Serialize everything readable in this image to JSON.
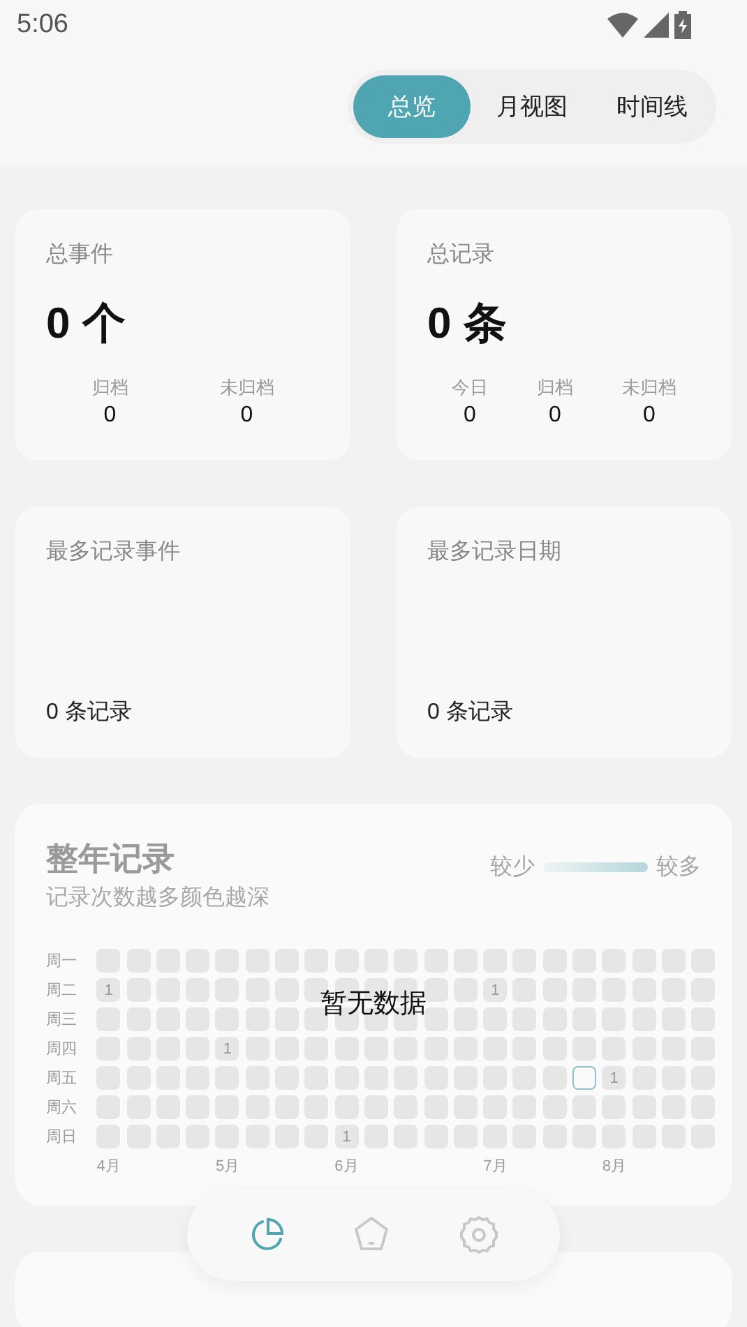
{
  "status_bar": {
    "time": "5:06"
  },
  "tabs": [
    {
      "label": "总览",
      "selected": true
    },
    {
      "label": "月视图",
      "selected": false
    },
    {
      "label": "时间线",
      "selected": false
    }
  ],
  "summary_cards": [
    {
      "title": "总事件",
      "value": "0 个",
      "stats": [
        {
          "label": "归档",
          "value": "0"
        },
        {
          "label": "未归档",
          "value": "0"
        }
      ]
    },
    {
      "title": "总记录",
      "value": "0 条",
      "stats": [
        {
          "label": "今日",
          "value": "0"
        },
        {
          "label": "归档",
          "value": "0"
        },
        {
          "label": "未归档",
          "value": "0"
        }
      ]
    }
  ],
  "top_cards": [
    {
      "title": "最多记录事件",
      "footer": "0 条记录"
    },
    {
      "title": "最多记录日期",
      "footer": "0 条记录"
    }
  ],
  "year_card": {
    "title": "整年记录",
    "subtitle": "记录次数越多颜色越深",
    "legend_low": "较少",
    "legend_high": "较多",
    "empty_message": "暂无数据",
    "weekdays": [
      "周一",
      "周二",
      "周三",
      "周四",
      "周五",
      "周六",
      "周日"
    ],
    "weeks": [
      {
        "month": "4月",
        "days": [
          {
            "today": false
          },
          {
            "today": false,
            "count": "1"
          },
          {
            "today": false
          },
          {
            "today": false
          },
          {
            "today": false
          },
          {
            "today": false
          },
          {
            "today": false
          }
        ]
      },
      {
        "days": [
          {
            "today": false
          },
          {
            "today": false
          },
          {
            "today": false
          },
          {
            "today": false
          },
          {
            "today": false
          },
          {
            "today": false
          },
          {
            "today": false
          }
        ]
      },
      {
        "days": [
          {
            "today": false
          },
          {
            "today": false
          },
          {
            "today": false
          },
          {
            "today": false
          },
          {
            "today": false
          },
          {
            "today": false
          },
          {
            "today": false
          }
        ]
      },
      {
        "days": [
          {
            "today": false
          },
          {
            "today": false
          },
          {
            "today": false
          },
          {
            "today": false
          },
          {
            "today": false
          },
          {
            "today": false
          },
          {
            "today": false
          }
        ]
      },
      {
        "month": "5月",
        "days": [
          {
            "today": false
          },
          {
            "today": false
          },
          {
            "today": false
          },
          {
            "today": false,
            "count": "1"
          },
          {
            "today": false
          },
          {
            "today": false
          },
          {
            "today": false
          }
        ]
      },
      {
        "days": [
          {
            "today": false
          },
          {
            "today": false
          },
          {
            "today": false
          },
          {
            "today": false
          },
          {
            "today": false
          },
          {
            "today": false
          },
          {
            "today": false
          }
        ]
      },
      {
        "days": [
          {
            "today": false
          },
          {
            "today": false
          },
          {
            "today": false
          },
          {
            "today": false
          },
          {
            "today": false
          },
          {
            "today": false
          },
          {
            "today": false
          }
        ]
      },
      {
        "days": [
          {
            "today": false
          },
          {
            "today": false
          },
          {
            "today": false
          },
          {
            "today": false
          },
          {
            "today": false
          },
          {
            "today": false
          },
          {
            "today": false
          }
        ]
      },
      {
        "month": "6月",
        "days": [
          {
            "today": false
          },
          {
            "today": false
          },
          {
            "today": false
          },
          {
            "today": false
          },
          {
            "today": false
          },
          {
            "today": false
          },
          {
            "today": false,
            "count": "1"
          }
        ]
      },
      {
        "days": [
          {
            "today": false
          },
          {
            "today": false
          },
          {
            "today": false
          },
          {
            "today": false
          },
          {
            "today": false
          },
          {
            "today": false
          },
          {
            "today": false
          }
        ]
      },
      {
        "days": [
          {
            "today": false
          },
          {
            "today": false
          },
          {
            "today": false
          },
          {
            "today": false
          },
          {
            "today": false
          },
          {
            "today": false
          },
          {
            "today": false
          }
        ]
      },
      {
        "days": [
          {
            "today": false
          },
          {
            "today": false
          },
          {
            "today": false
          },
          {
            "today": false
          },
          {
            "today": false
          },
          {
            "today": false
          },
          {
            "today": false
          }
        ]
      },
      {
        "days": [
          {
            "today": false
          },
          {
            "today": false
          },
          {
            "today": false
          },
          {
            "today": false
          },
          {
            "today": false
          },
          {
            "today": false
          },
          {
            "today": false
          }
        ]
      },
      {
        "month": "7月",
        "days": [
          {
            "today": false
          },
          {
            "today": false,
            "count": "1"
          },
          {
            "today": false
          },
          {
            "today": false
          },
          {
            "today": false
          },
          {
            "today": false
          },
          {
            "today": false
          }
        ]
      },
      {
        "days": [
          {
            "today": false
          },
          {
            "today": false
          },
          {
            "today": false
          },
          {
            "today": false
          },
          {
            "today": false
          },
          {
            "today": false
          },
          {
            "today": false
          }
        ]
      },
      {
        "days": [
          {
            "today": false
          },
          {
            "today": false
          },
          {
            "today": false
          },
          {
            "today": false
          },
          {
            "today": false
          },
          {
            "today": false
          },
          {
            "today": false
          }
        ]
      },
      {
        "days": [
          {
            "today": false
          },
          {
            "today": false
          },
          {
            "today": false
          },
          {
            "today": false
          },
          {
            "today": true
          },
          {
            "today": false
          },
          {
            "today": false
          }
        ]
      },
      {
        "month": "8月",
        "days": [
          {
            "today": false
          },
          {
            "today": false
          },
          {
            "today": false
          },
          {
            "today": false
          },
          {
            "today": false,
            "count": "1"
          },
          {
            "today": false
          },
          {
            "today": false
          }
        ]
      },
      {
        "days": [
          {
            "today": false
          },
          {
            "today": false
          },
          {
            "today": false
          },
          {
            "today": false
          },
          {
            "today": false
          },
          {
            "today": false
          },
          {
            "today": false
          }
        ]
      },
      {
        "days": [
          {
            "today": false
          },
          {
            "today": false
          },
          {
            "today": false
          },
          {
            "today": false
          },
          {
            "today": false
          },
          {
            "today": false
          },
          {
            "today": false
          }
        ]
      },
      {
        "days": [
          {
            "today": false
          },
          {
            "today": false
          },
          {
            "today": false
          },
          {
            "today": false
          },
          {
            "today": false
          },
          {
            "today": false
          },
          {
            "today": false
          }
        ]
      }
    ]
  },
  "bottom_nav": [
    {
      "kind": "stats",
      "selected": true
    },
    {
      "kind": "home",
      "selected": false
    },
    {
      "kind": "settings",
      "selected": false
    }
  ]
}
